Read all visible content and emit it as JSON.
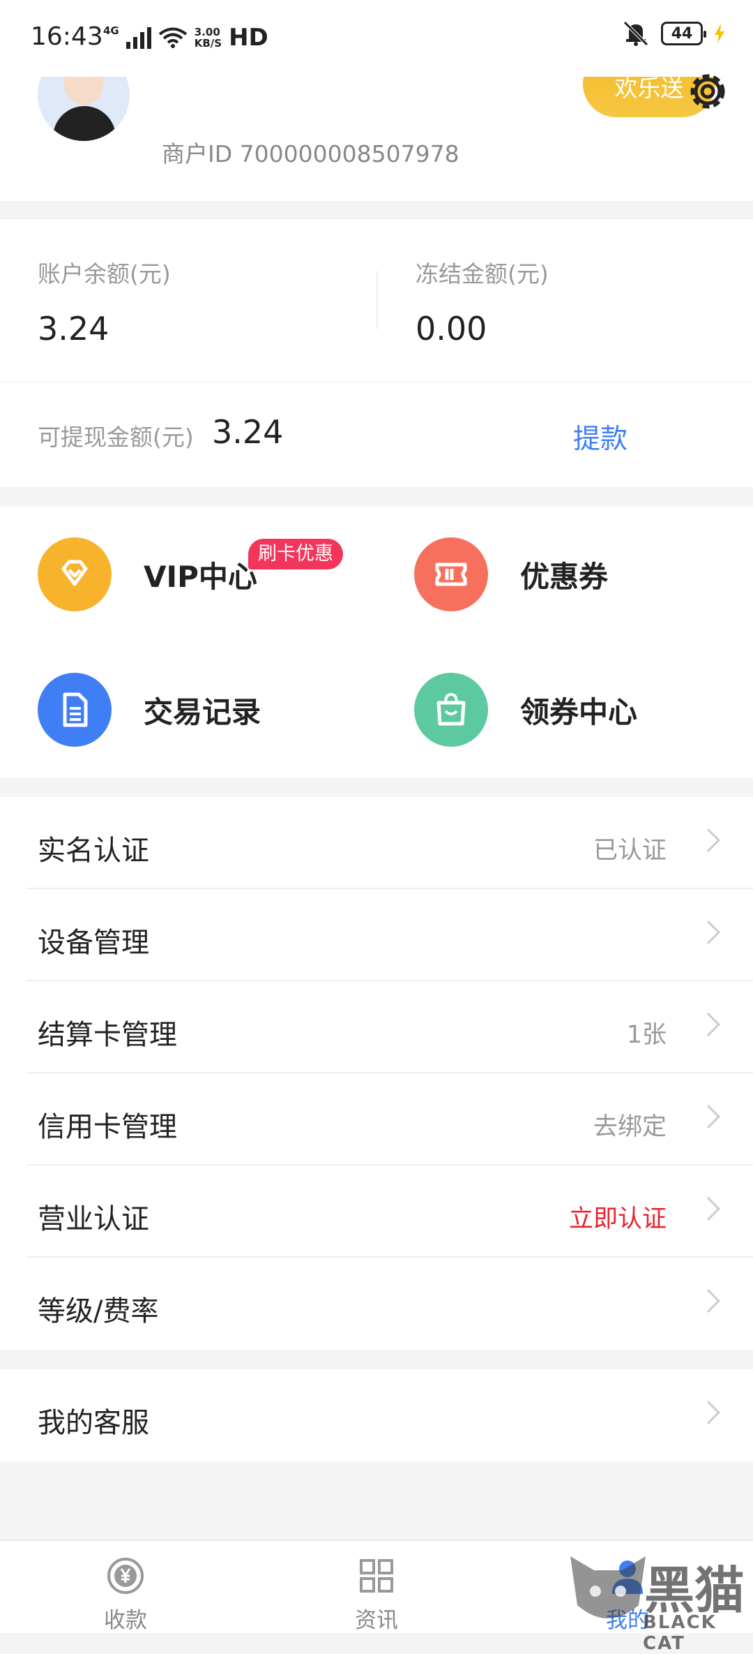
{
  "status_bar": {
    "time": "16:43",
    "network": "4G",
    "speed_value": "3.00",
    "speed_unit": "KB/S",
    "hd": "HD",
    "battery": "44"
  },
  "header": {
    "merchant_id": "商户ID 700000008507978",
    "gift_button": "欢乐送"
  },
  "balance": {
    "account_label": "账户余额(元)",
    "account_value": "3.24",
    "frozen_label": "冻结金额(元)",
    "frozen_value": "0.00"
  },
  "withdraw": {
    "label": "可提现金额(元)",
    "value": "3.24",
    "action": "提款"
  },
  "quick_menu": [
    {
      "label": "VIP中心",
      "badge": "刷卡优惠",
      "icon": "diamond-icon",
      "color": "#f8b32d"
    },
    {
      "label": "优惠券",
      "icon": "ticket-icon",
      "color": "#f7705d"
    },
    {
      "label": "交易记录",
      "icon": "document-icon",
      "color": "#3f7ef5"
    },
    {
      "label": "领券中心",
      "icon": "shopping-bag-icon",
      "color": "#5cc9a0"
    }
  ],
  "settings_list": [
    {
      "label": "实名认证",
      "value": "已认证"
    },
    {
      "label": "设备管理",
      "value": ""
    },
    {
      "label": "结算卡管理",
      "value": "1张"
    },
    {
      "label": "信用卡管理",
      "value": "去绑定"
    },
    {
      "label": "营业认证",
      "value": "立即认证",
      "value_color": "#e8232f"
    },
    {
      "label": "等级/费率",
      "value": ""
    }
  ],
  "support_list": [
    {
      "label": "我的客服",
      "value": ""
    }
  ],
  "tab_bar": [
    {
      "label": "收款",
      "icon": "yen-coin-icon",
      "active": false
    },
    {
      "label": "资讯",
      "icon": "grid-icon",
      "active": false
    },
    {
      "label": "我的",
      "icon": "person-icon",
      "active": true
    }
  ],
  "watermark": {
    "text": "黑猫",
    "subtext": "BLACK CAT"
  }
}
